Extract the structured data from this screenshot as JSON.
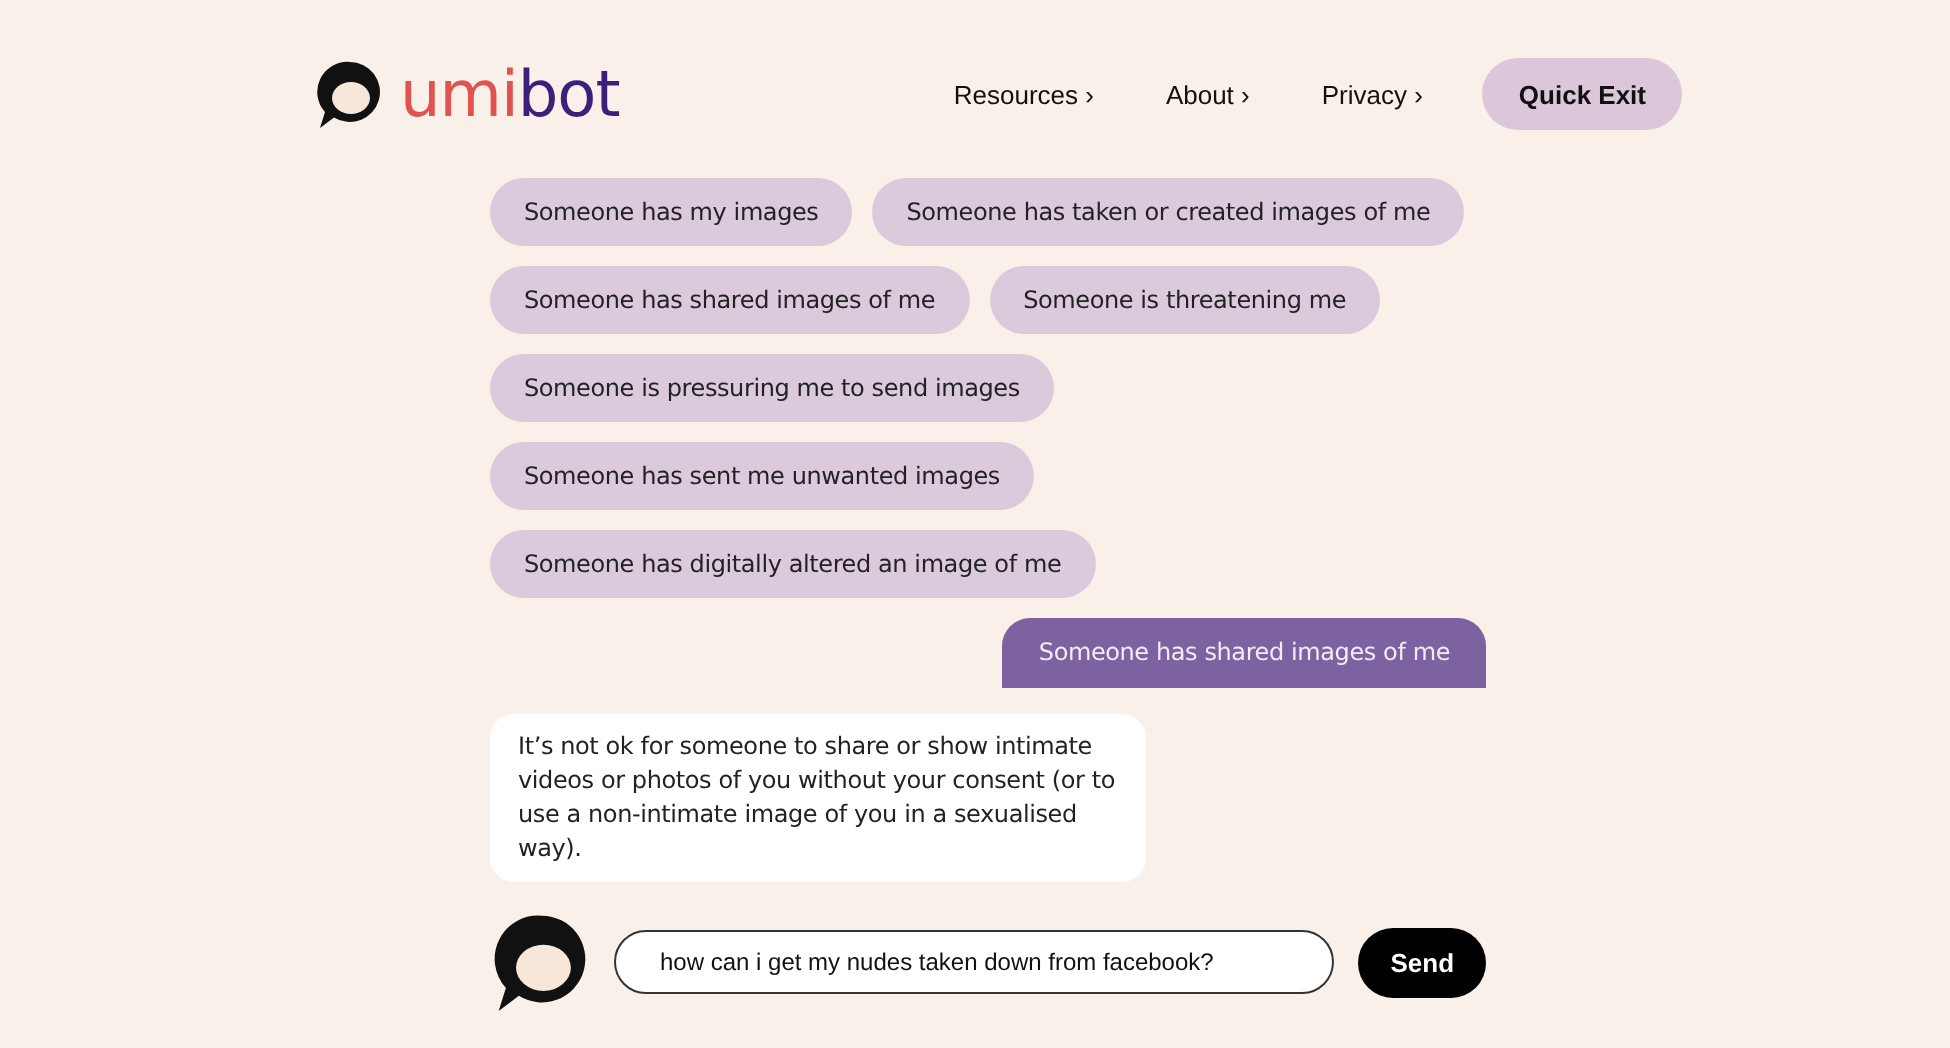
{
  "header": {
    "logo_parts": [
      {
        "text": "umi",
        "color": "#e0534f"
      },
      {
        "text": "bot",
        "color": "#3b1f78"
      }
    ],
    "nav": [
      {
        "label": "Resources",
        "chevron": "›"
      },
      {
        "label": "About",
        "chevron": "›"
      },
      {
        "label": "Privacy",
        "chevron": "›"
      }
    ],
    "exit_button": "Quick Exit"
  },
  "options": [
    [
      "Someone has my images",
      "Someone has taken or created images of me"
    ],
    [
      "Someone has shared images of me",
      "Someone is threatening me"
    ],
    [
      "Someone is pressuring me to send images"
    ],
    [
      "Someone has sent me unwanted images"
    ],
    [
      "Someone has digitally altered an image of me"
    ]
  ],
  "messages": [
    {
      "kind": "user",
      "text": "Someone has shared images of me"
    },
    {
      "kind": "bot",
      "text": "It’s not ok for someone to share or show intimate videos or photos of you without your consent (or to use a non-intimate image of you in a sexualised way)."
    }
  ],
  "composer": {
    "value": "how can i get my nudes taken down from facebook?",
    "send": "Send"
  }
}
